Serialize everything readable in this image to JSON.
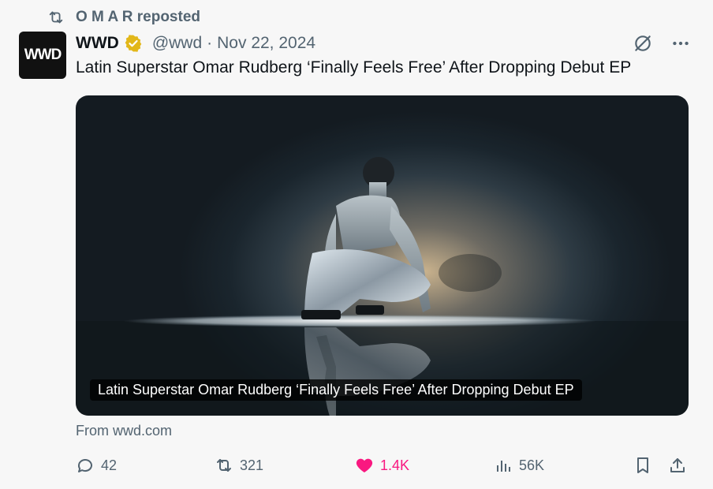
{
  "repost": {
    "label": "O M A R reposted"
  },
  "author": {
    "avatar_text": "WWD",
    "name": "WWD",
    "handle": "@wwd",
    "date": "Nov 22, 2024"
  },
  "tweet": {
    "text": "Latin Superstar Omar Rudberg ‘Finally Feels Free’ After Dropping Debut EP"
  },
  "card": {
    "caption": "Latin Superstar Omar Rudberg ‘Finally Feels Free’ After Dropping Debut EP",
    "from": "From wwd.com"
  },
  "actions": {
    "replies": "42",
    "reposts": "321",
    "likes": "1.4K",
    "views": "56K"
  },
  "colors": {
    "like": "#f91880",
    "muted": "#536471",
    "verified": "#e2b719"
  }
}
